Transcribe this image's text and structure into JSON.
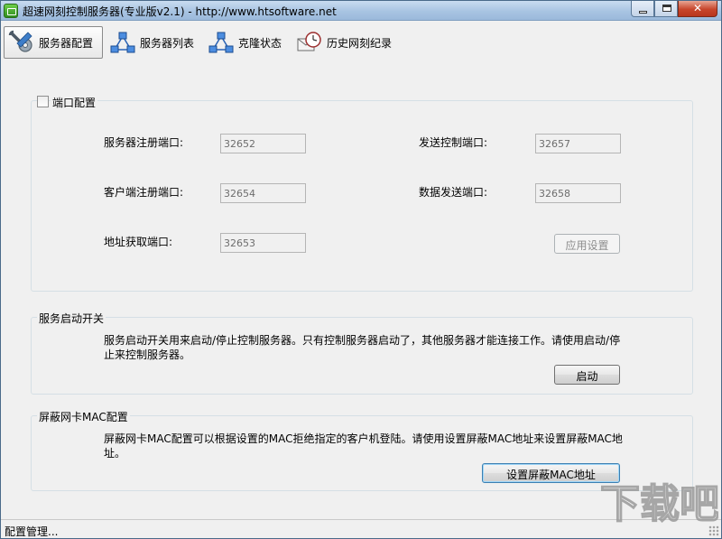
{
  "window": {
    "title": "超速网刻控制服务器(专业版v2.1) - http://www.htsoftware.net",
    "minimize_glyph": "–",
    "close_glyph": "✕"
  },
  "toolbar": {
    "items": [
      {
        "label": "服务器配置",
        "icon": "wrench-gear-icon",
        "active": true
      },
      {
        "label": "服务器列表",
        "icon": "network-nodes-icon",
        "active": false
      },
      {
        "label": "克隆状态",
        "icon": "network-nodes-icon",
        "active": false
      },
      {
        "label": "历史网刻纪录",
        "icon": "clock-envelope-icon",
        "active": false
      }
    ]
  },
  "port_config": {
    "title": "端口配置",
    "checked": false,
    "fields": {
      "server_reg": {
        "label": "服务器注册端口:",
        "value": "32652"
      },
      "client_reg": {
        "label": "客户端注册端口:",
        "value": "32654"
      },
      "addr_fetch": {
        "label": "地址获取端口:",
        "value": "32653"
      },
      "send_ctrl": {
        "label": "发送控制端口:",
        "value": "32657"
      },
      "data_send": {
        "label": "数据发送端口:",
        "value": "32658"
      }
    },
    "apply_label": "应用设置"
  },
  "service_switch": {
    "title": "服务启动开关",
    "desc_line1": "服务启动开关用来启动/停止控制服务器。只有控制服务器启动了，其他服务器才能连接工作。请使用启动/停",
    "desc_line2": "止来控制服务器。",
    "start_label": "启动"
  },
  "mac_config": {
    "title": "屏蔽网卡MAC配置",
    "desc_line1": "屏蔽网卡MAC配置可以根据设置的MAC拒绝指定的客户机登陆。请使用设置屏蔽MAC地址来设置屏蔽MAC地",
    "desc_line2": "址。",
    "set_label": "设置屏蔽MAC地址"
  },
  "status": {
    "text": "配置管理..."
  },
  "watermark": {
    "text": "下载吧"
  }
}
